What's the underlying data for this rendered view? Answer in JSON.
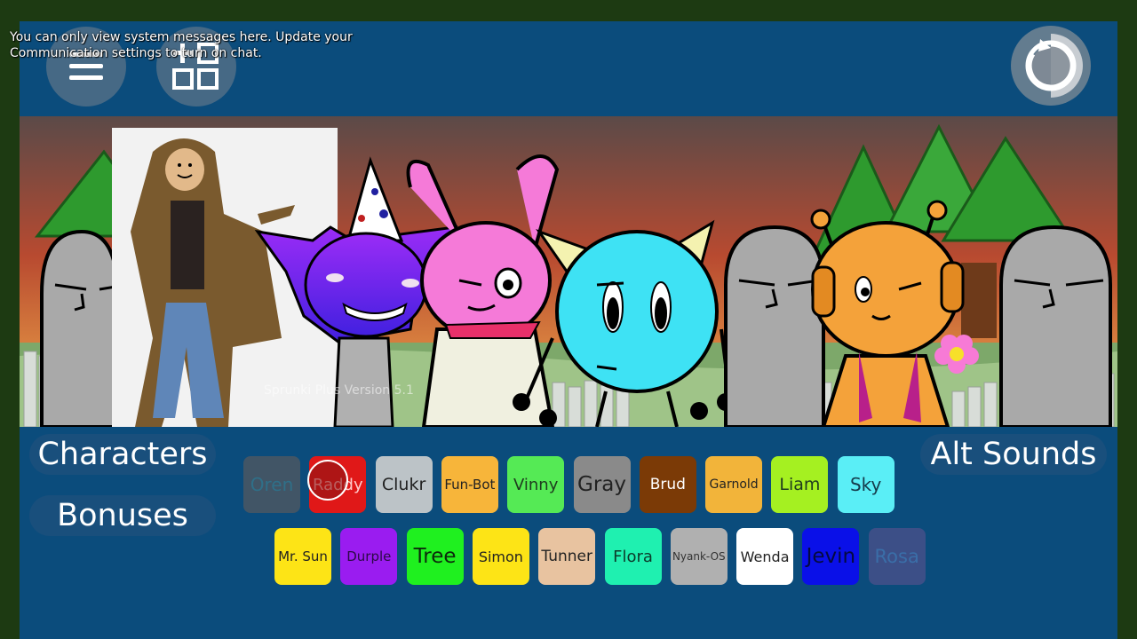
{
  "chat": {
    "system_message": "You can only view system messages here. Update your Communication settings to turn on chat."
  },
  "top_buttons": {
    "menu_icon": "hamburger-menu-icon",
    "grid_icon": "add-grid-icon",
    "reset_icon": "reset-circular-arrow-icon"
  },
  "stage": {
    "watermark": "Sprunki Plus Version 5.1"
  },
  "nav": {
    "characters_label": "Characters",
    "bonuses_label": "Bonuses",
    "alt_sounds_label": "Alt Sounds"
  },
  "tiles_row1": [
    {
      "label": "Oren",
      "bg": "#415566",
      "fg": "#2f6f88",
      "size": 20
    },
    {
      "label": "Raddy",
      "bg": "#e01818",
      "fg": "#ffcccc",
      "size": 18
    },
    {
      "label": "Clukr",
      "bg": "#bcc3c7",
      "fg": "#222222",
      "size": 19
    },
    {
      "label": "Fun-Bot",
      "bg": "#f7b53a",
      "fg": "#222222",
      "size": 15
    },
    {
      "label": "Vinny",
      "bg": "#55ea55",
      "fg": "#1e3b1e",
      "size": 18
    },
    {
      "label": "Gray",
      "bg": "#8a8a8a",
      "fg": "#222222",
      "size": 23
    },
    {
      "label": "Brud",
      "bg": "#7b3a06",
      "fg": "#ffffff",
      "size": 17
    },
    {
      "label": "Garnold",
      "bg": "#f2b43a",
      "fg": "#222222",
      "size": 14
    },
    {
      "label": "Liam",
      "bg": "#a5f021",
      "fg": "#1e3b1e",
      "size": 19
    },
    {
      "label": "Sky",
      "bg": "#5aeef6",
      "fg": "#153a4a",
      "size": 20
    }
  ],
  "tiles_row2": [
    {
      "label": "Mr. Sun",
      "bg": "#fde416",
      "fg": "#222222",
      "size": 15
    },
    {
      "label": "Durple",
      "bg": "#9a1cf0",
      "fg": "#2b0a45",
      "size": 15
    },
    {
      "label": "Tree",
      "bg": "#1ff01f",
      "fg": "#0c2a0c",
      "size": 23
    },
    {
      "label": "Simon",
      "bg": "#fde416",
      "fg": "#222222",
      "size": 16
    },
    {
      "label": "Tunner",
      "bg": "#e8c3a0",
      "fg": "#222222",
      "size": 17
    },
    {
      "label": "Flora",
      "bg": "#1ff0b0",
      "fg": "#0c3a2a",
      "size": 18
    },
    {
      "label": "Nyank-OS",
      "bg": "#b0b0b0",
      "fg": "#333333",
      "size": 12
    },
    {
      "label": "Wenda",
      "bg": "#ffffff",
      "fg": "#222222",
      "size": 16
    },
    {
      "label": "Jevin",
      "bg": "#0a10e8",
      "fg": "#050a40",
      "size": 23
    },
    {
      "label": "Rosa",
      "bg": "#3c4f87",
      "fg": "#3a6ea8",
      "size": 21
    }
  ]
}
